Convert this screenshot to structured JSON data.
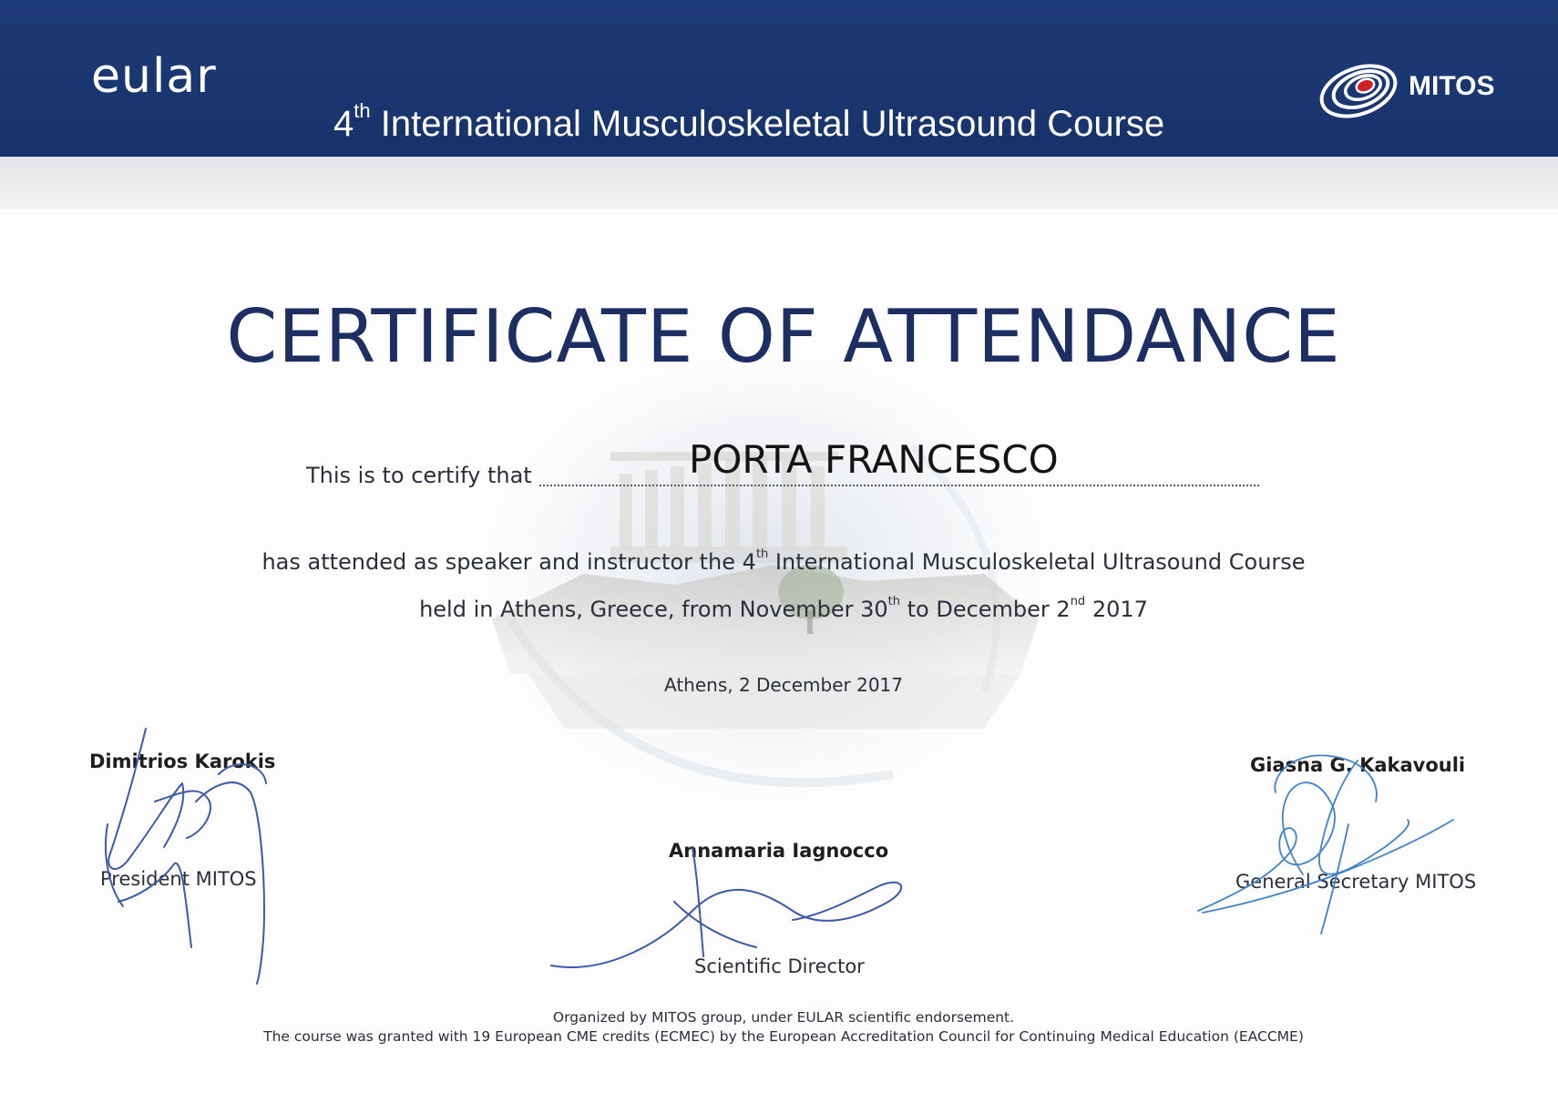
{
  "header": {
    "eular_logo": "eular",
    "course_title_prefix": "4",
    "course_title_sup": "th",
    "course_title_rest": " International Musculoskeletal Ultrasound Course",
    "mitos_logo": "MITOS"
  },
  "certificate": {
    "title": "CERTIFICATE OF ATTENDANCE",
    "certify_label": "This is to certify that",
    "recipient": "PORTA FRANCESCO",
    "line1_a": "has attended as speaker and instructor the 4",
    "line1_sup": "th",
    "line1_b": " International Musculoskeletal Ultrasound Course",
    "line2_a": "held in Athens, Greece, from November 30",
    "line2_sup1": "th",
    "line2_b": " to December 2",
    "line2_sup2": "nd",
    "line2_c": " 2017",
    "place_date": "Athens, 2 December 2017"
  },
  "signatories": {
    "left": {
      "name": "Dimitrios Karokis",
      "role": "President MITOS"
    },
    "middle": {
      "name": "Annamaria Iagnocco",
      "role": "Scientific Director"
    },
    "right": {
      "name": "Giasna G. Kakavouli",
      "role": "General Secretary MITOS"
    }
  },
  "footer": {
    "line1": "Organized by MITOS group, under EULAR scientific endorsement.",
    "line2": "The course was granted with 19 European CME credits (ECMEC) by the European Accreditation Council for Continuing Medical Education (EACCME)"
  },
  "colors": {
    "header_blue": "#1d3b78",
    "title_navy": "#1c2e62",
    "signature_ink": "#3a5fae",
    "mitos_red": "#d0202a"
  },
  "icons": {
    "mitos_logo_mark": "concentric-ellipses-icon"
  }
}
